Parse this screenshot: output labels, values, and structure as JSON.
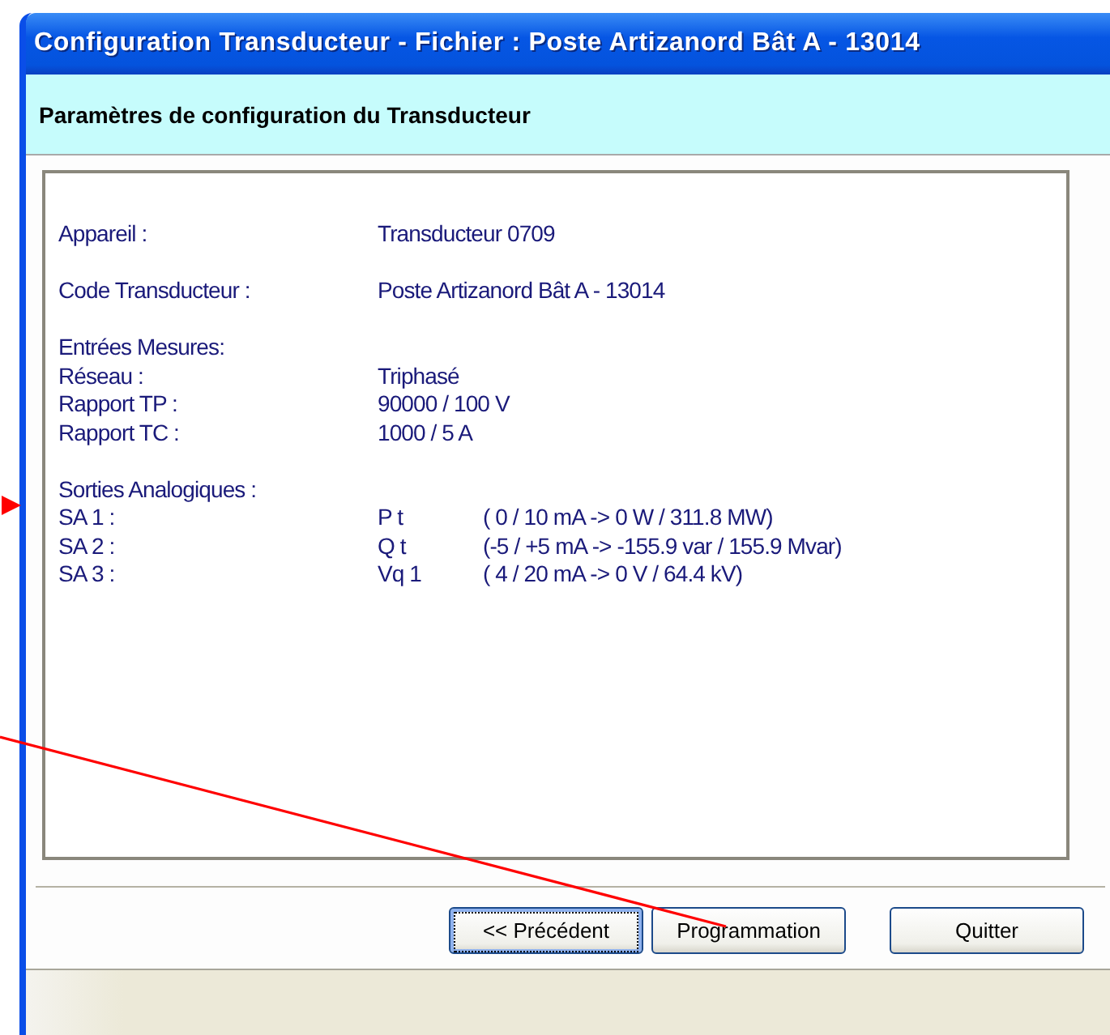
{
  "window": {
    "title": "Configuration Transducteur - Fichier : Poste Artizanord Bât A - 13014"
  },
  "header": {
    "title": "Paramètres de configuration du Transducteur"
  },
  "groups": [
    {
      "rows": [
        {
          "label": "Appareil :",
          "value": "Transducteur 0709"
        }
      ]
    },
    {
      "rows": [
        {
          "label": "Code Transducteur :",
          "value": "Poste Artizanord Bât A - 13014"
        }
      ]
    },
    {
      "rows": [
        {
          "label": "Entrées Mesures:"
        },
        {
          "label": "Réseau :",
          "value": "Triphasé"
        },
        {
          "label": "Rapport TP :",
          "value": "90000 / 100 V"
        },
        {
          "label": "Rapport TC :",
          "value": "1000 / 5 A"
        }
      ]
    },
    {
      "rows": [
        {
          "label": "Sorties Analogiques :"
        },
        {
          "label": "SA 1 :",
          "value": "P t",
          "detail": "( 0 / 10 mA ->  0 W / 311.8 MW)"
        },
        {
          "label": "SA 2 :",
          "value": "Q t",
          "detail": "(-5 / +5 mA ->  -155.9 var / 155.9 Mvar)"
        },
        {
          "label": "SA 3 :",
          "value": "Vq 1",
          "detail": "( 4 / 20 mA ->  0 V / 64.4 kV)"
        }
      ]
    }
  ],
  "buttons": [
    {
      "label": "<< Précédent",
      "focused": true
    },
    {
      "label": "Programmation",
      "focused": false
    },
    {
      "label": "Quitter",
      "focused": false
    }
  ]
}
